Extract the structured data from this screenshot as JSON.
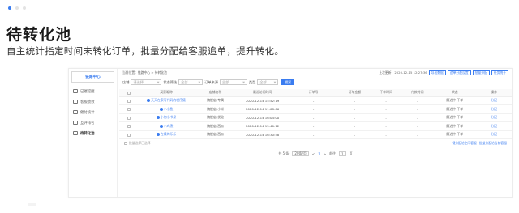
{
  "carousel": {
    "dot_count": 3,
    "active_index": 0,
    "accent": "#3a7cf0"
  },
  "hero": {
    "title": "待转化池",
    "subtitle": "自主统计指定时间未转化订单，批量分配给客服追单，提升转化。"
  },
  "sidebar": {
    "header": "链路中心",
    "items": [
      {
        "label": "已催提醒",
        "icon": "calendar-icon",
        "active": false
      },
      {
        "label": "客服绩效",
        "icon": "chart-icon",
        "active": false
      },
      {
        "label": "催付统计",
        "icon": "list-icon",
        "active": false
      },
      {
        "label": "互评排名",
        "icon": "trend-icon",
        "active": false
      },
      {
        "label": "待转化池",
        "icon": "pool-icon",
        "active": true
      }
    ]
  },
  "topbar": {
    "breadcrumb": "当前位置：链路中心 > 待转化池",
    "last_update": "上次更新：2020-12-15 12:27:36",
    "buttons": [
      "导出数据",
      "追单分配设置",
      "批量分配",
      "任务统计"
    ]
  },
  "filters": {
    "shop_label": "店铺",
    "shop_value": "请选择",
    "state_label": "状态筛选",
    "state_value": "全部",
    "source_label": "订单来源",
    "source_value": "全部",
    "type_label": "类型",
    "type_value": "全部",
    "search_label": "搜索"
  },
  "table": {
    "columns": [
      "",
      "买家昵称",
      "店铺名称",
      "最近访问时间",
      "订单号",
      "订单金额",
      "下单时间",
      "付款时间",
      "状态",
      "操作"
    ],
    "rows": [
      {
        "name": "天天在家写代码的程序猿",
        "shop": "旗舰店-专属",
        "time": "2020-12-14 15:52:19",
        "order": "-",
        "amount": "-",
        "placed": "-",
        "paid": "-",
        "status": "跟进中 下单",
        "action": "分配"
      },
      {
        "name": "小小鱼",
        "shop": "旗舰店-小米",
        "time": "2020-12-14 11:08:06",
        "order": "-",
        "amount": "-",
        "placed": "-",
        "paid": "-",
        "status": "跟进中 下单",
        "action": "分配"
      },
      {
        "name": "小何小书呆",
        "shop": "旗舰店-优化",
        "time": "2020-12-14 16:04:00",
        "order": "-",
        "amount": "-",
        "placed": "-",
        "paid": "-",
        "status": "跟进中 下单",
        "action": "分配"
      },
      {
        "name": "小鸡煮",
        "shop": "旗舰店-西瓜",
        "time": "2020-12-14 15:40:12",
        "order": "-",
        "amount": "-",
        "placed": "-",
        "paid": "-",
        "status": "跟进中 下单",
        "action": "分配"
      },
      {
        "name": "在线的乐乐",
        "shop": "旗舰店-西瓜",
        "time": "2020-12-14 16:30:58",
        "order": "-",
        "amount": "-",
        "placed": "-",
        "paid": "-",
        "status": "跟进中 下单",
        "action": "分配"
      }
    ]
  },
  "table_footer": {
    "selected": "批量选择已选择",
    "links": [
      "一键分配给空闲客服",
      "批量分配给当前客服"
    ]
  },
  "pager": {
    "total": "共 5 条",
    "page_size": "20条/页",
    "prev": "<",
    "current": "1",
    "next": ">",
    "goto_label": "前往",
    "goto_value": "1",
    "page_unit": "页"
  }
}
